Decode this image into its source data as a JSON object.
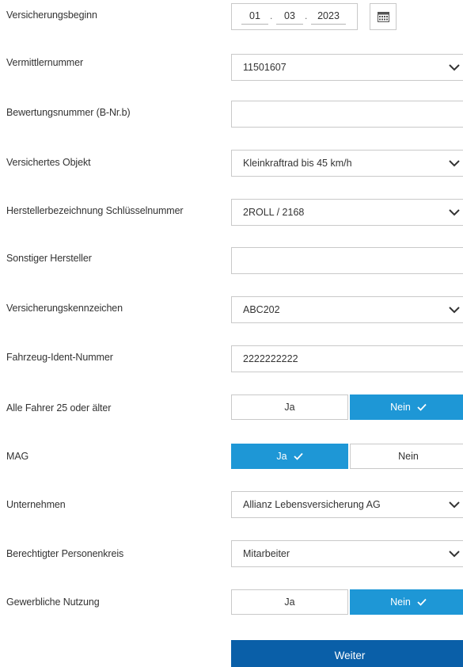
{
  "fields": {
    "versicherungsbeginn": {
      "label": "Versicherungsbeginn",
      "day": "01",
      "month": "03",
      "year": "2023",
      "separator": "."
    },
    "vermittlernummer": {
      "label": "Vermittlernummer",
      "value": "11501607"
    },
    "bewertungsnummer": {
      "label": "Bewertungsnummer (B-Nr.b)",
      "value": ""
    },
    "versichertes_objekt": {
      "label": "Versichertes Objekt",
      "value": "Kleinkraftrad bis 45 km/h"
    },
    "herstellerbezeichnung": {
      "label": "Herstellerbezeichnung Schlüsselnummer",
      "value": "2ROLL / 2168"
    },
    "sonstiger_hersteller": {
      "label": "Sonstiger Hersteller",
      "value": ""
    },
    "versicherungskennzeichen": {
      "label": "Versicherungskennzeichen",
      "value": "ABC202"
    },
    "fahrzeug_ident": {
      "label": "Fahrzeug-Ident-Nummer",
      "value": "2222222222"
    },
    "alle_fahrer": {
      "label": "Alle Fahrer 25 oder älter",
      "yes": "Ja",
      "no": "Nein",
      "selected": "Nein"
    },
    "mag": {
      "label": "MAG",
      "yes": "Ja",
      "no": "Nein",
      "selected": "Ja"
    },
    "unternehmen": {
      "label": "Unternehmen",
      "value": "Allianz Lebensversicherung AG"
    },
    "personenkreis": {
      "label": "Berechtigter Personenkreis",
      "value": "Mitarbeiter"
    },
    "gewerbliche_nutzung": {
      "label": "Gewerbliche Nutzung",
      "yes": "Ja",
      "no": "Nein",
      "selected": "Nein"
    }
  },
  "actions": {
    "weiter_label": "Weiter"
  },
  "icons": {
    "calendar": "calendar-icon",
    "dropdown": "chevron-down-icon",
    "selected": "check-icon"
  },
  "colors": {
    "toggle_active": "#1e97d6",
    "primary_button": "#0a5fa8",
    "border": "#c9c9c9",
    "text": "#333333"
  }
}
